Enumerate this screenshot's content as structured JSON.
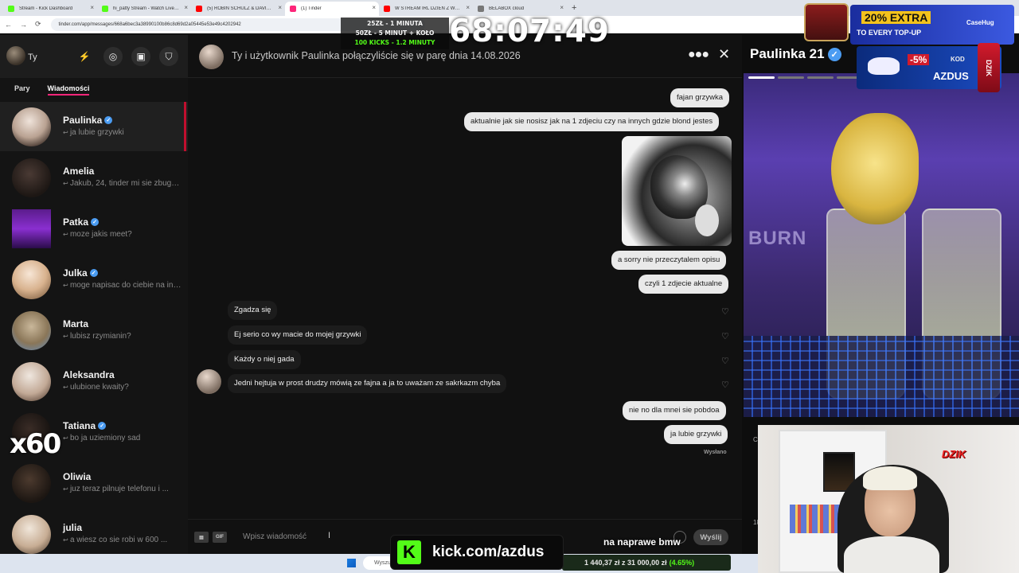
{
  "browser": {
    "tabs": [
      {
        "label": "Stream - Kick Dashboard",
        "color": "#53fc18"
      },
      {
        "label": "hi_patty Stream - Watch Live on Kick",
        "color": "#53fc18"
      },
      {
        "label": "(5) ROBIN SCHULZ & DAVID GUETTA",
        "color": "#ff0000"
      },
      {
        "label": "(1) Tinder",
        "color": "#fd267a"
      },
      {
        "label": "W STREAM IRL DZIEN Z WERONIKA",
        "color": "#ff0000"
      },
      {
        "label": "BELABOX cloud",
        "color": "#777777"
      }
    ],
    "new_tab": "+",
    "url": "tinder.com/app/messages/668a6bec3a38990100b86c8d69d2a05445e53e49c4202942",
    "nav": {
      "back": "←",
      "forward": "→",
      "reload": "⟳"
    }
  },
  "sidebar": {
    "me_label": "Ty",
    "tabs": [
      "Pary",
      "Wiadomości"
    ],
    "conversations": [
      {
        "name": "Paulinka",
        "verified": true,
        "preview": "ja lubie grzywki",
        "active": true
      },
      {
        "name": "Amelia",
        "verified": false,
        "preview": "Jakub, 24, tinder mi sie zbugował",
        "active": false
      },
      {
        "name": "Patka",
        "verified": true,
        "preview": "moze jakis meet?",
        "active": false
      },
      {
        "name": "Julka",
        "verified": true,
        "preview": "moge napisac do ciebie na insta?",
        "active": false
      },
      {
        "name": "Marta",
        "verified": false,
        "preview": "lubisz rzymianin?",
        "active": false
      },
      {
        "name": "Aleksandra",
        "verified": false,
        "preview": "ulubione kwaity?",
        "active": false
      },
      {
        "name": "Tatiana",
        "verified": true,
        "preview": "bo ja uziemiony sad",
        "active": false
      },
      {
        "name": "Oliwia",
        "verified": false,
        "preview": "juz teraz pilnuje telefonu i ...",
        "active": false
      },
      {
        "name": "julia",
        "verified": false,
        "preview": "a wiesz co sie robi w 600 ...",
        "active": false
      }
    ]
  },
  "chat": {
    "header_title": "Ty i użytkownik Paulinka połączyliście się w parę dnia 14.08.2026",
    "messages": [
      {
        "dir": "out",
        "text": "fajan grzywka"
      },
      {
        "dir": "out",
        "text": "aktualnie jak sie nosisz jak na 1 zdjeciu czy na innych gdzie blond jestes"
      },
      {
        "dir": "out",
        "text": "a sorry nie przeczytalem opisu"
      },
      {
        "dir": "out",
        "text": "czyli 1 zdjecie aktualne"
      },
      {
        "dir": "in",
        "text": "Zgadza się"
      },
      {
        "dir": "in",
        "text": "Ej serio co wy macie do mojej grzywki"
      },
      {
        "dir": "in",
        "text": "Każdy o niej gada"
      },
      {
        "dir": "in",
        "text": "Jedni hejtuja w prost drudzy mówią ze fajna a ja to uważam ze sakrkazm chyba"
      },
      {
        "dir": "out",
        "text": "nie no dla mnei sie pobdoa"
      },
      {
        "dir": "out",
        "text": "ja lubie grzywki"
      }
    ],
    "sent_status": "Wysłano",
    "input_placeholder": "Wpisz wiadomość",
    "gif_label": "GIF",
    "send_label": "Wyślij"
  },
  "profile": {
    "name_age": "Paulinka 21",
    "photo_text": "BURN"
  },
  "overlays": {
    "timer": "68:07:49",
    "tier_lines": [
      "25ZŁ - 1 MINUTA",
      "50ZŁ - 5 MINUT + KOŁO",
      "100 KICKS - 1.2 MINUTY"
    ],
    "ad_extra": "20% EXTRA",
    "ad_topup": "TO EVERY TOP-UP",
    "ad_brand": "CaseHug",
    "ad_discount": "-5%",
    "ad_kod": "KOD",
    "ad_code": "AZDUS",
    "can_label": "DZIK",
    "x60": "x60",
    "kick_url": "kick.com/azdus",
    "kick_logo": "K",
    "bottom_text": "na naprawe bmw",
    "webcam_logo": "DZIK",
    "stock_text": "1 440,37 zł z 31 000,00 zł",
    "stock_pct": "(4.65%)",
    "taskbar_search": "Wyszukaj",
    "side_frag": "C",
    "side_frag2": "18"
  },
  "colors": {
    "tinder_accent": "#fd267a",
    "kick_green": "#53fc18",
    "verified_blue": "#4b9cf2"
  }
}
